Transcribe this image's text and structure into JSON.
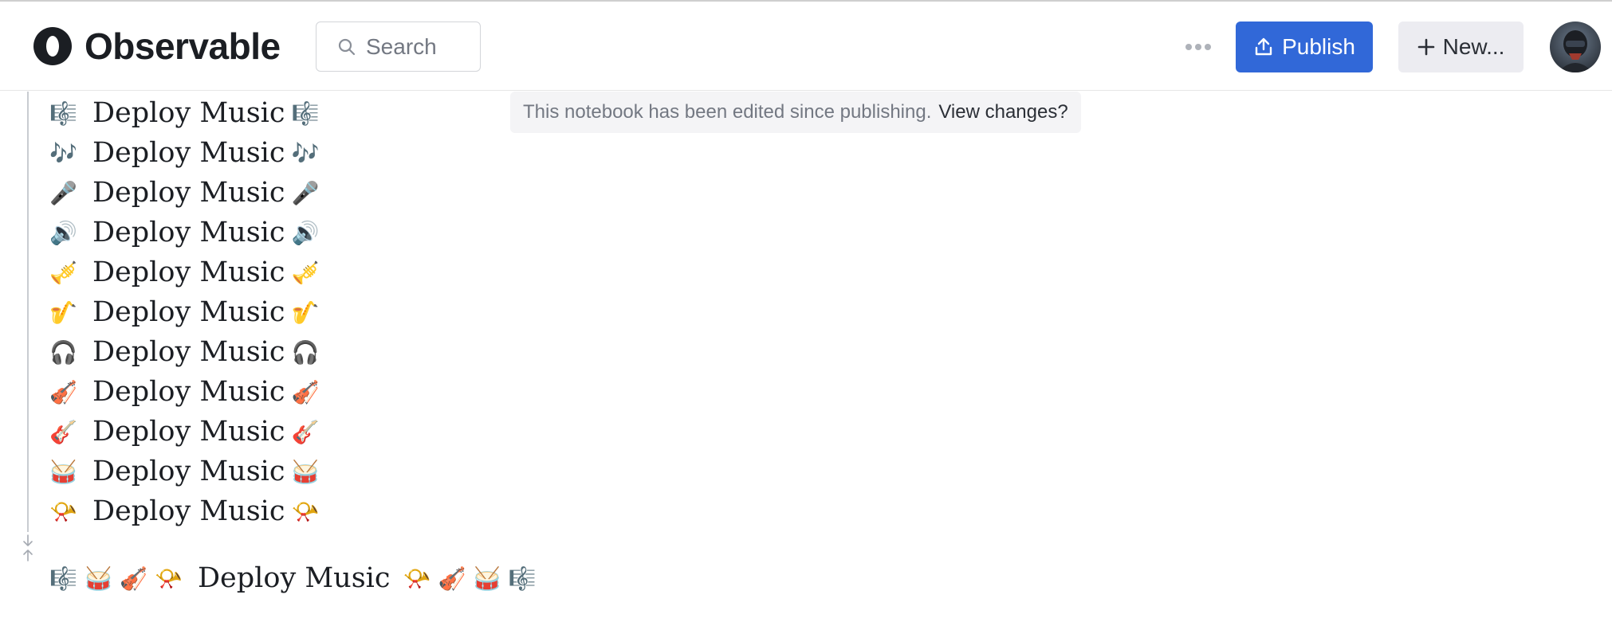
{
  "header": {
    "logo_text": "Observable",
    "search_placeholder": "Search",
    "more_icon": "more-horizontal-icon",
    "publish_label": "Publish",
    "new_label": "New..."
  },
  "banner": {
    "text": "This notebook has been edited since publishing.",
    "link": "View changes?"
  },
  "music_list": [
    {
      "emoji": "🎼",
      "text": "Deploy Music"
    },
    {
      "emoji": "🎶",
      "text": "Deploy Music"
    },
    {
      "emoji": "🎤",
      "text": "Deploy Music"
    },
    {
      "emoji": "🔊",
      "text": "Deploy Music"
    },
    {
      "emoji": "🎺",
      "text": "Deploy Music"
    },
    {
      "emoji": "🎷",
      "text": "Deploy Music"
    },
    {
      "emoji": "🎧",
      "text": "Deploy Music"
    },
    {
      "emoji": "🎻",
      "text": "Deploy Music"
    },
    {
      "emoji": "🎸",
      "text": "Deploy Music"
    },
    {
      "emoji": "🥁",
      "text": "Deploy Music"
    },
    {
      "emoji": "📯",
      "text": "Deploy Music"
    }
  ],
  "final_line": {
    "leading_emojis": [
      "🎼",
      "🥁",
      "🎻",
      "📯"
    ],
    "text": "Deploy Music",
    "trailing_emojis": [
      "📯",
      "🎻",
      "🥁",
      "🎼"
    ]
  },
  "colors": {
    "accent": "#3168d8",
    "text": "#1b1e23",
    "muted": "#737882"
  }
}
